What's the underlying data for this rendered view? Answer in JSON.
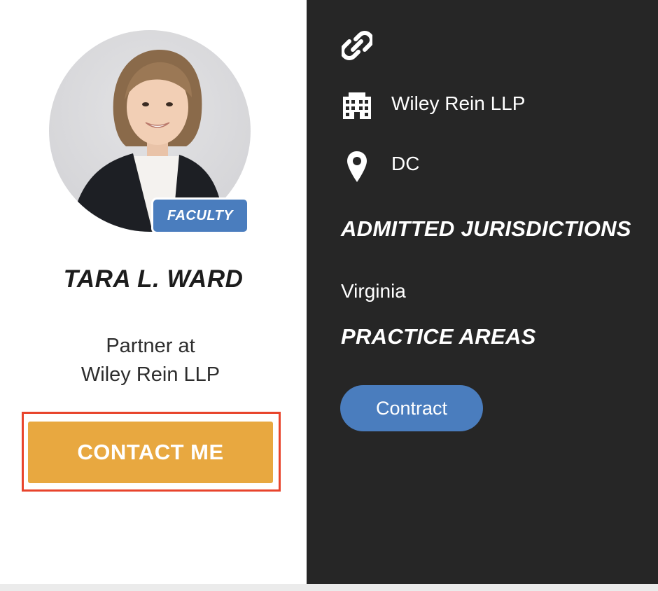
{
  "profile": {
    "badge": "FACULTY",
    "name": "TARA L. WARD",
    "role_line1": "Partner at",
    "role_line2": "Wiley Rein LLP",
    "contact_button": "CONTACT ME"
  },
  "details": {
    "icons": {
      "link": "link-icon",
      "firm": "building-icon",
      "location": "location-pin-icon"
    },
    "firm": "Wiley Rein LLP",
    "location": "DC",
    "admitted_heading": "ADMITTED JURISDICTIONS",
    "jurisdictions": [
      "Virginia"
    ],
    "practice_heading": "PRACTICE AREAS",
    "practice_areas": [
      "Contract"
    ]
  },
  "colors": {
    "accent_blue": "#4a7dbe",
    "contact_orange": "#e8a840",
    "dark_panel": "#262626",
    "highlight_red": "#e8442c"
  }
}
